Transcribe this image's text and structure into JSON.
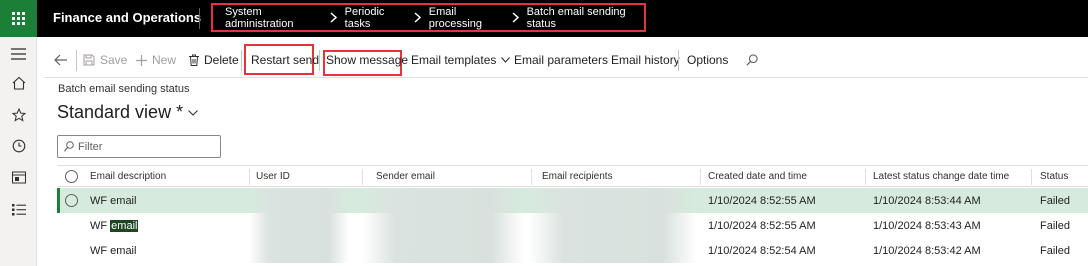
{
  "header": {
    "app_title": "Finance and Operations",
    "breadcrumb": [
      "System administration",
      "Periodic tasks",
      "Email processing",
      "Batch email sending status"
    ]
  },
  "leftnav": {
    "icons": [
      "hamburger-icon",
      "home-icon",
      "star-icon",
      "clock-icon",
      "workspace-icon",
      "list-icon"
    ]
  },
  "toolbar": {
    "back": "back-arrow-icon",
    "save": "Save",
    "new": "New",
    "delete": "Delete",
    "restart_send": "Restart send",
    "show_message": "Show message",
    "email_templates": "Email templates",
    "email_parameters": "Email parameters",
    "email_history": "Email history",
    "options": "Options",
    "search": "search-icon"
  },
  "page": {
    "crumb": "Batch email sending status",
    "view_title": "Standard view",
    "view_modified": "*"
  },
  "filter": {
    "placeholder": "Filter"
  },
  "grid": {
    "columns": [
      "Email description",
      "User ID",
      "Sender email",
      "Email recipients",
      "Created date and time",
      "Latest status change date time",
      "Status"
    ],
    "rows": [
      {
        "description": "WF email",
        "created": "1/10/2024 8:52:55 AM",
        "latest": "1/10/2024 8:53:44 AM",
        "status": "Failed",
        "selected": true
      },
      {
        "description_prefix": "WF ",
        "description_highlight": "email",
        "created": "1/10/2024 8:52:55 AM",
        "latest": "1/10/2024 8:53:43 AM",
        "status": "Failed",
        "selected": false
      },
      {
        "description": "WF email",
        "created": "1/10/2024 8:52:54 AM",
        "latest": "1/10/2024 8:53:42 AM",
        "status": "Failed",
        "selected": false
      }
    ]
  },
  "colors": {
    "brand": "#1b7f37",
    "highlight_box": "#e8313f",
    "selected_row": "#d6ebdd"
  }
}
